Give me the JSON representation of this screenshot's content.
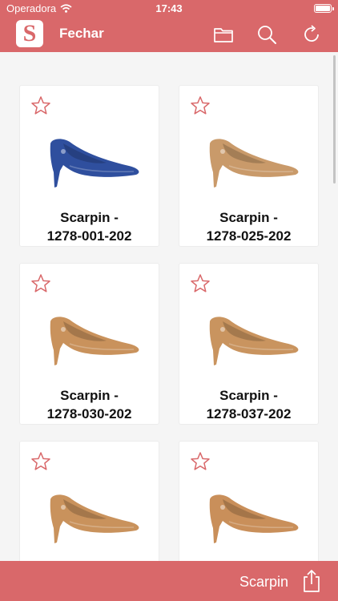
{
  "status_bar": {
    "carrier": "Operadora",
    "time": "17:43"
  },
  "nav": {
    "logo_letter": "S",
    "close_label": "Fechar",
    "icons": [
      "folder-icon",
      "search-icon",
      "refresh-icon"
    ]
  },
  "products": [
    {
      "name_line1": "Scarpin -",
      "name_line2": "1278-001-202",
      "color": "#2f4f9e",
      "favorite": false
    },
    {
      "name_line1": "Scarpin -",
      "name_line2": "1278-025-202",
      "color": "#c99a6a",
      "favorite": false
    },
    {
      "name_line1": "Scarpin -",
      "name_line2": "1278-030-202",
      "color": "#c9925c",
      "favorite": false
    },
    {
      "name_line1": "Scarpin -",
      "name_line2": "1278-037-202",
      "color": "#c9945f",
      "favorite": false
    },
    {
      "name_line1": "",
      "name_line2": "",
      "color": "#c9925c",
      "favorite": false
    },
    {
      "name_line1": "",
      "name_line2": "",
      "color": "#c98f5a",
      "favorite": false
    }
  ],
  "bottom_bar": {
    "title": "Scarpin",
    "share_icon": "share-icon"
  },
  "colors": {
    "brand": "#d9686a",
    "background": "#f5f5f5"
  }
}
